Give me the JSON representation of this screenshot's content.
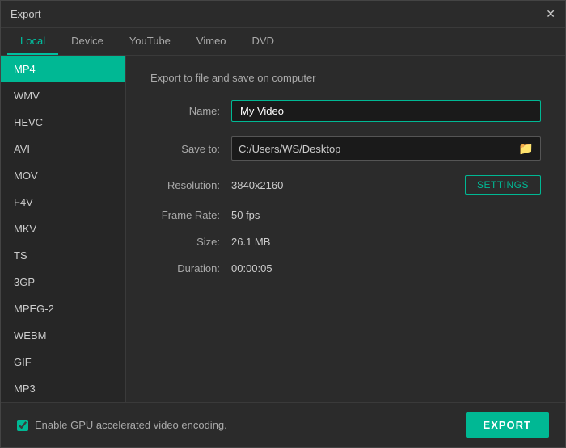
{
  "window": {
    "title": "Export"
  },
  "tabs": [
    {
      "label": "Local",
      "active": true
    },
    {
      "label": "Device",
      "active": false
    },
    {
      "label": "YouTube",
      "active": false
    },
    {
      "label": "Vimeo",
      "active": false
    },
    {
      "label": "DVD",
      "active": false
    }
  ],
  "sidebar": {
    "items": [
      {
        "label": "MP4",
        "active": true
      },
      {
        "label": "WMV",
        "active": false
      },
      {
        "label": "HEVC",
        "active": false
      },
      {
        "label": "AVI",
        "active": false
      },
      {
        "label": "MOV",
        "active": false
      },
      {
        "label": "F4V",
        "active": false
      },
      {
        "label": "MKV",
        "active": false
      },
      {
        "label": "TS",
        "active": false
      },
      {
        "label": "3GP",
        "active": false
      },
      {
        "label": "MPEG-2",
        "active": false
      },
      {
        "label": "WEBM",
        "active": false
      },
      {
        "label": "GIF",
        "active": false
      },
      {
        "label": "MP3",
        "active": false
      }
    ]
  },
  "main": {
    "section_title": "Export to file and save on computer",
    "name_label": "Name:",
    "name_value": "My Video",
    "name_placeholder": "My Video",
    "save_to_label": "Save to:",
    "save_to_value": "C:/Users/WS/Desktop",
    "resolution_label": "Resolution:",
    "resolution_value": "3840x2160",
    "settings_label": "SETTINGS",
    "frame_rate_label": "Frame Rate:",
    "frame_rate_value": "50 fps",
    "size_label": "Size:",
    "size_value": "26.1 MB",
    "duration_label": "Duration:",
    "duration_value": "00:00:05"
  },
  "footer": {
    "gpu_label": "Enable GPU accelerated video encoding.",
    "export_label": "EXPORT"
  },
  "icons": {
    "close": "✕",
    "folder": "🗁",
    "checkbox_checked": true
  }
}
